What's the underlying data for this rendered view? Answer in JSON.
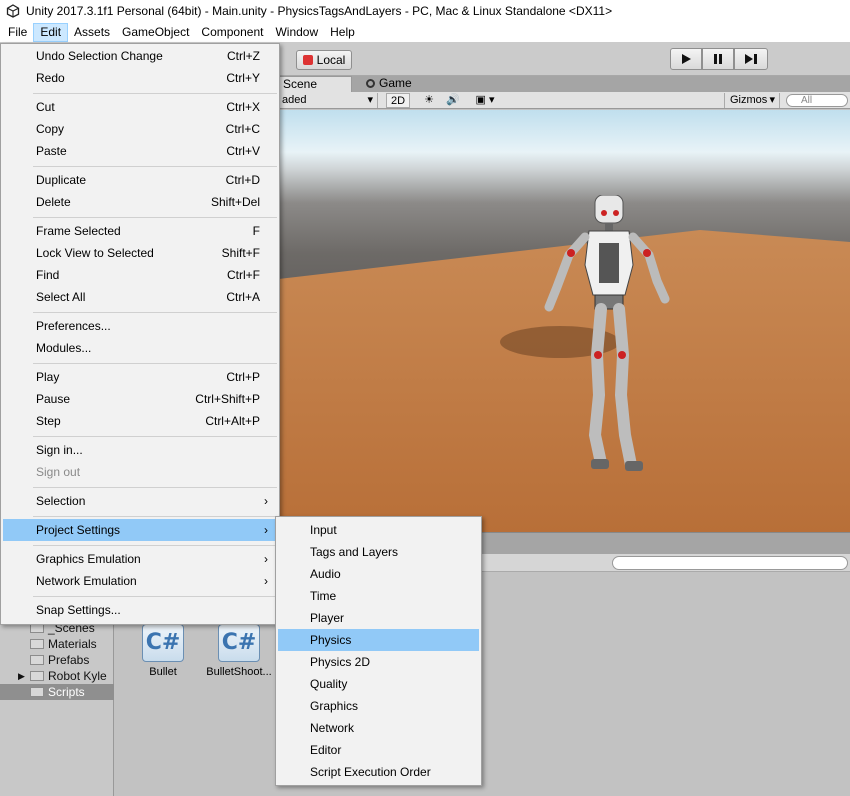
{
  "window": {
    "title": "Unity 2017.3.1f1 Personal (64bit) - Main.unity - PhysicsTagsAndLayers - PC, Mac & Linux Standalone <DX11>"
  },
  "menubar": {
    "items": [
      "File",
      "Edit",
      "Assets",
      "GameObject",
      "Component",
      "Window",
      "Help"
    ],
    "active": "Edit"
  },
  "toolbar": {
    "pivot_label": "Local"
  },
  "tabs": {
    "scene": "Scene",
    "game": "Game"
  },
  "scene_toolbar": {
    "shading_mode": "aded",
    "twod": "2D",
    "gizmos": "Gizmos",
    "search_placeholder": "All"
  },
  "edit_menu": {
    "items": [
      {
        "label": "Undo Selection Change",
        "shortcut": "Ctrl+Z"
      },
      {
        "label": "Redo",
        "shortcut": "Ctrl+Y"
      },
      {
        "label": "Cut",
        "shortcut": "Ctrl+X"
      },
      {
        "label": "Copy",
        "shortcut": "Ctrl+C"
      },
      {
        "label": "Paste",
        "shortcut": "Ctrl+V"
      },
      {
        "label": "Duplicate",
        "shortcut": "Ctrl+D"
      },
      {
        "label": "Delete",
        "shortcut": "Shift+Del"
      },
      {
        "label": "Frame Selected",
        "shortcut": "F"
      },
      {
        "label": "Lock View to Selected",
        "shortcut": "Shift+F"
      },
      {
        "label": "Find",
        "shortcut": "Ctrl+F"
      },
      {
        "label": "Select All",
        "shortcut": "Ctrl+A"
      },
      {
        "label": "Preferences...",
        "shortcut": ""
      },
      {
        "label": "Modules...",
        "shortcut": ""
      },
      {
        "label": "Play",
        "shortcut": "Ctrl+P"
      },
      {
        "label": "Pause",
        "shortcut": "Ctrl+Shift+P"
      },
      {
        "label": "Step",
        "shortcut": "Ctrl+Alt+P"
      },
      {
        "label": "Sign in...",
        "shortcut": ""
      },
      {
        "label": "Sign out",
        "shortcut": ""
      },
      {
        "label": "Selection",
        "shortcut": ""
      },
      {
        "label": "Project Settings",
        "shortcut": ""
      },
      {
        "label": "Graphics Emulation",
        "shortcut": ""
      },
      {
        "label": "Network Emulation",
        "shortcut": ""
      },
      {
        "label": "Snap Settings...",
        "shortcut": ""
      }
    ],
    "highlighted": "Project Settings",
    "disabled": [
      "Sign out"
    ],
    "submenu_arrow": "›"
  },
  "project_settings_submenu": {
    "items": [
      "Input",
      "Tags and Layers",
      "Audio",
      "Time",
      "Player",
      "Physics",
      "Physics 2D",
      "Quality",
      "Graphics",
      "Network",
      "Editor",
      "Script Execution Order"
    ],
    "highlighted": "Physics"
  },
  "project_tree": {
    "items": [
      "_Scenes",
      "Materials",
      "Prefabs",
      "Robot Kyle",
      "Scripts"
    ],
    "selected": "Scripts"
  },
  "assets": [
    {
      "name": "Bullet",
      "icon": "C#"
    },
    {
      "name": "BulletShoot...",
      "icon": "C#"
    }
  ],
  "colors": {
    "menu_highlight": "#91c9f7",
    "menu_active_top": "#cce8ff",
    "ground": "#c07840"
  }
}
